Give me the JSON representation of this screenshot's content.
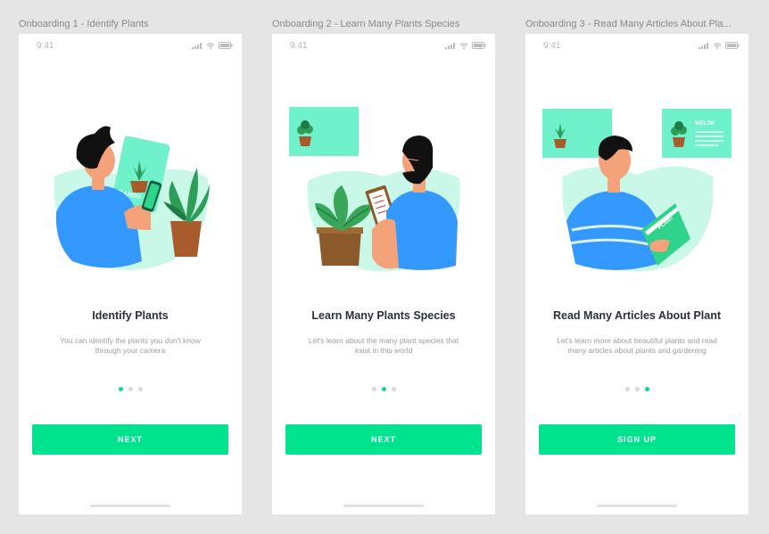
{
  "screens": [
    {
      "frame_label": "Onboarding 1 - Identify Plants",
      "time": "9:41",
      "title": "Identify Plants",
      "desc_line1": "You can identify the plants you don't know",
      "desc_line2": "through your camera",
      "button": "NEXT",
      "card_text": "GANDU"
    },
    {
      "frame_label": "Onboarding 2 - Learn Many Plants Species",
      "time": "9:41",
      "title": "Learn Many Plants Species",
      "desc_line1": "Let's learn about the many plant species that",
      "desc_line2": "exist in this world",
      "button": "NEXT"
    },
    {
      "frame_label": "Onboarding 3 - Read Many Articles About Pla...",
      "time": "9:41",
      "title": "Read Many Articles About Plant",
      "desc_line1": "Let's learn more about beautiful plants and read",
      "desc_line2": "many articles about plants and gardening",
      "button": "SIGN UP",
      "card_text": "WELOK",
      "book_text": "PLANT"
    }
  ],
  "active_page": [
    1,
    2,
    3
  ],
  "colors": {
    "accent": "#00e38e",
    "mint": "#6ff2cc",
    "mint_light": "#c9f7e8",
    "shirt": "#3399ff",
    "skin": "#f4a27a",
    "hair": "#111111"
  }
}
